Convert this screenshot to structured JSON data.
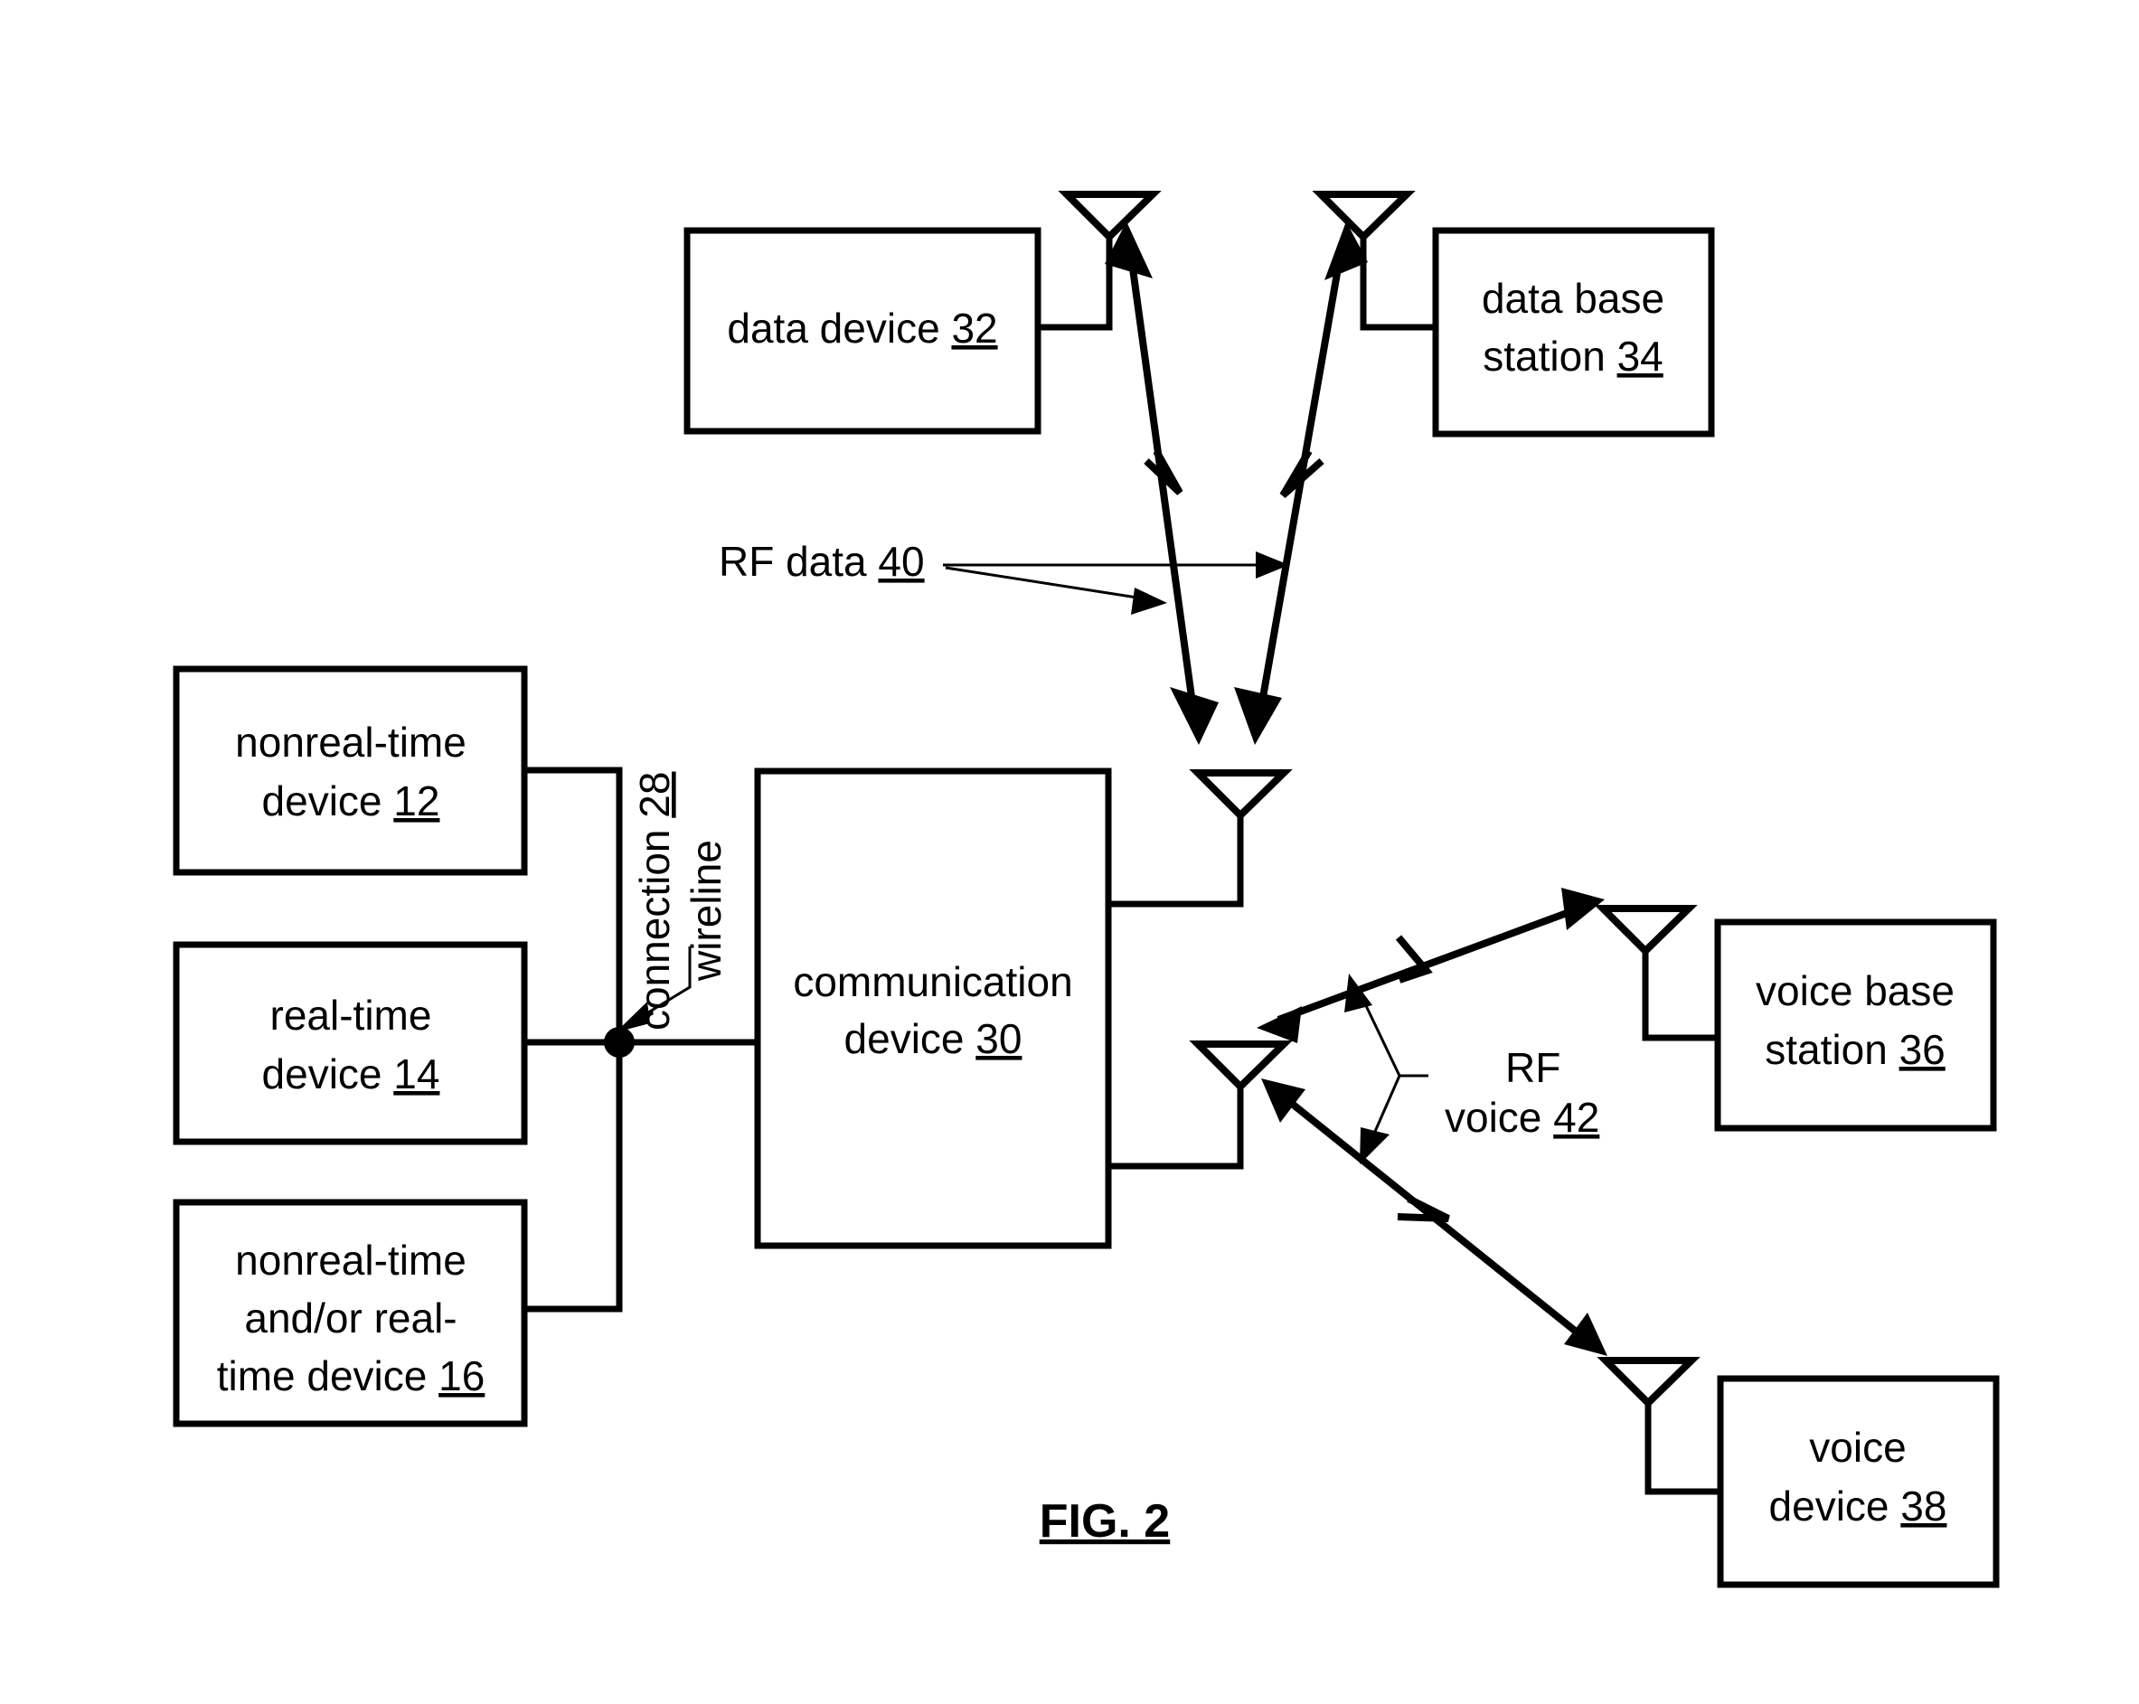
{
  "figure": {
    "caption": "FIG. 2",
    "background_color": "#ffffff",
    "line_color": "#000000"
  },
  "blocks": [
    {
      "id": "data-device",
      "lines": [
        "data device "
      ],
      "ref": "32"
    },
    {
      "id": "data-base-station",
      "lines": [
        "data base",
        "station "
      ],
      "ref": "34"
    },
    {
      "id": "nonreal-time-device",
      "lines": [
        "nonreal-time",
        "device "
      ],
      "ref": "12"
    },
    {
      "id": "real-time-device",
      "lines": [
        "real-time",
        "device "
      ],
      "ref": "14"
    },
    {
      "id": "nonreal-or-real-time-device",
      "lines": [
        "nonreal-time",
        "and/or real-",
        "time device "
      ],
      "ref": "16"
    },
    {
      "id": "communication-device",
      "lines": [
        "communication",
        "device "
      ],
      "ref": "30"
    },
    {
      "id": "voice-base-station",
      "lines": [
        "voice base",
        "station "
      ],
      "ref": "36"
    },
    {
      "id": "voice-device",
      "lines": [
        "voice",
        "device "
      ],
      "ref": "38"
    }
  ],
  "labels": {
    "rf_data": {
      "text": "RF data ",
      "ref": "40"
    },
    "rf_voice_line1": "RF",
    "rf_voice_line2": "voice ",
    "rf_voice_ref": "42",
    "wireline_line1": "wireline",
    "wireline_line2": "connection ",
    "wireline_ref": "28"
  },
  "block_text": {
    "data_device_l1": "data device ",
    "data_device_ref": "32",
    "data_base_station_l1": "data base",
    "data_base_station_l2": "station ",
    "data_base_station_ref": "34",
    "nonreal_time_device_l1": "nonreal-time",
    "nonreal_time_device_l2": "device ",
    "nonreal_time_device_ref": "12",
    "real_time_device_l1": "real-time",
    "real_time_device_l2": "device ",
    "real_time_device_ref": "14",
    "mixed_device_l1": "nonreal-time",
    "mixed_device_l2": "and/or real-",
    "mixed_device_l3": "time device ",
    "mixed_device_ref": "16",
    "communication_device_l1": "communication",
    "communication_device_l2": "device ",
    "communication_device_ref": "30",
    "voice_base_station_l1": "voice base",
    "voice_base_station_l2": "station ",
    "voice_base_station_ref": "36",
    "voice_device_l1": "voice",
    "voice_device_l2": "device ",
    "voice_device_ref": "38"
  },
  "icons": {
    "antenna_data_device": "antenna-icon",
    "antenna_data_base_station": "antenna-icon",
    "antenna_comm_data": "antenna-icon",
    "antenna_comm_voice": "antenna-icon",
    "antenna_voice_base_station": "antenna-icon",
    "antenna_voice_device": "antenna-icon"
  }
}
